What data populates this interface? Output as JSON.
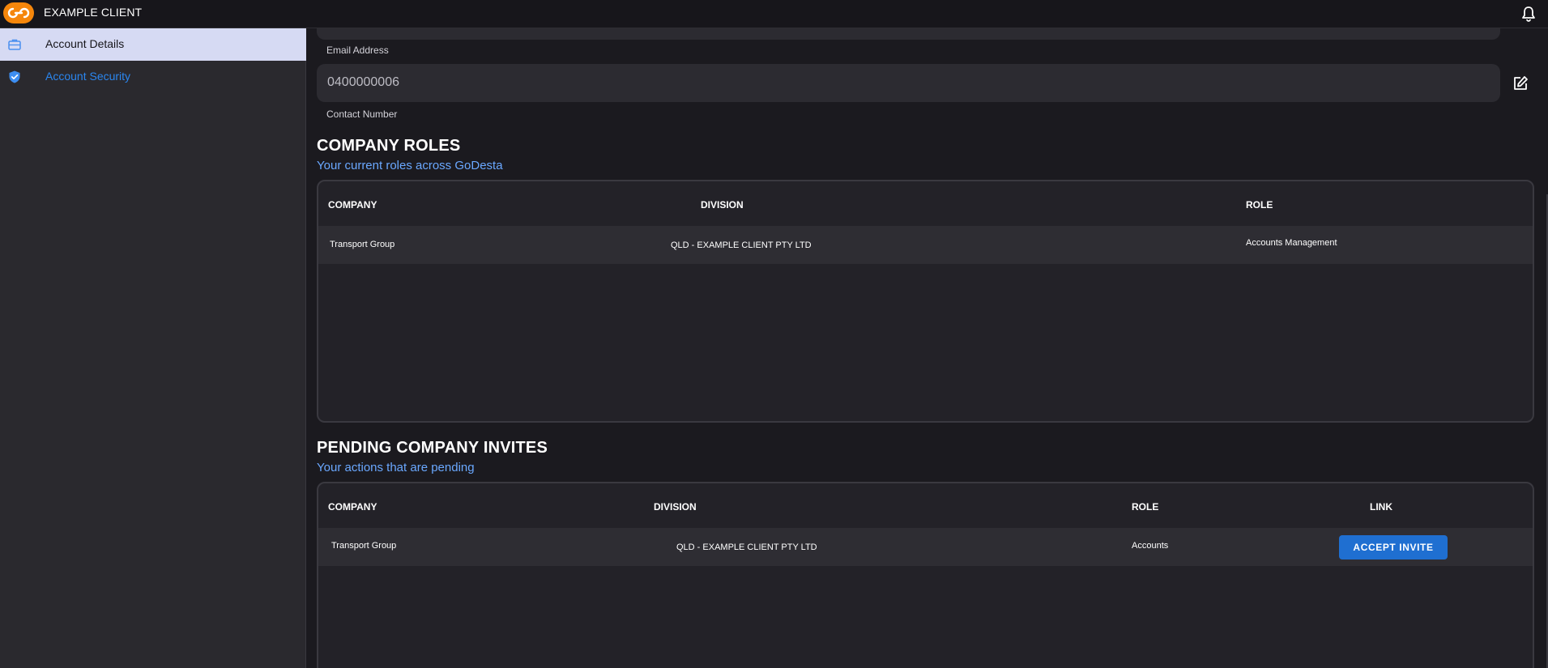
{
  "app": {
    "title": "EXAMPLE CLIENT"
  },
  "sidebar": {
    "items": [
      {
        "label": "Account Details",
        "icon": "briefcase-icon",
        "active": true
      },
      {
        "label": "Account Security",
        "icon": "shield-check-icon",
        "active": false
      }
    ]
  },
  "fields": {
    "email": {
      "label": "Email Address"
    },
    "contact": {
      "label": "Contact Number",
      "value": "0400000006"
    }
  },
  "roles": {
    "title": "COMPANY ROLES",
    "subtitle": "Your current roles across GoDesta",
    "headers": [
      "COMPANY",
      "DIVISION",
      "ROLE"
    ],
    "rows": [
      {
        "company": "Transport Group",
        "division": "QLD - EXAMPLE CLIENT PTY LTD",
        "role": "Accounts Management"
      }
    ]
  },
  "invites": {
    "title": "PENDING COMPANY INVITES",
    "subtitle": "Your actions that are pending",
    "headers": [
      "COMPANY",
      "DIVISION",
      "ROLE",
      "LINK"
    ],
    "rows": [
      {
        "company": "Transport Group",
        "division": "QLD - EXAMPLE CLIENT PTY LTD",
        "role": "Accounts",
        "action": "ACCEPT INVITE"
      }
    ]
  },
  "colors": {
    "accent": "#1f6fd1",
    "brand": "#f5860b",
    "link": "#2a86ef",
    "subtitle": "#6aa8ff",
    "active_sidebar": "#d6daf3"
  }
}
